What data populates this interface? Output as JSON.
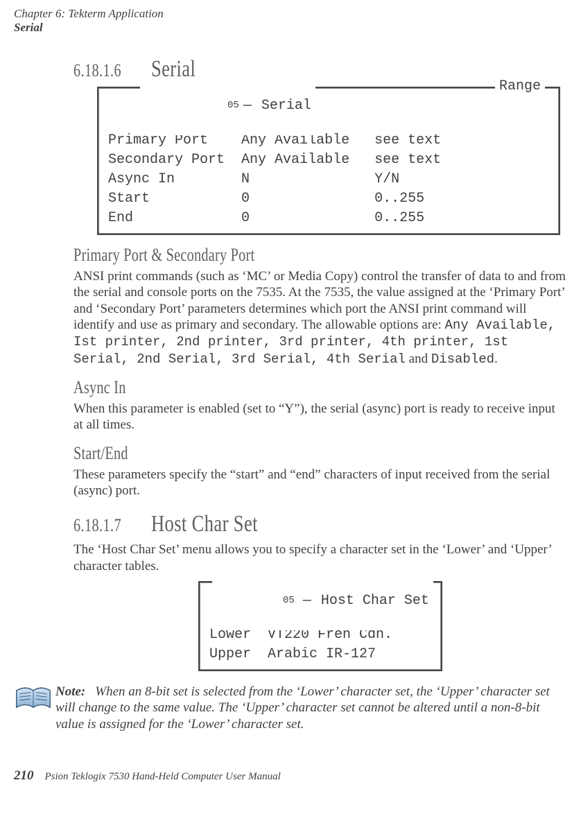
{
  "running_header": {
    "chapter": "Chapter  6:   Tekterm Application",
    "serial": "Serial"
  },
  "section_6_18_1_6": {
    "num": "6.18.1.6",
    "title": "Serial"
  },
  "serial_box": {
    "legend_left_num": "05",
    "legend_left_label": "Serial",
    "legend_right": "Range",
    "rows": [
      {
        "label": "Primary Port",
        "value": "Any Available",
        "range": "see text"
      },
      {
        "label": "Secondary Port",
        "value": "Any Available",
        "range": "see text"
      },
      {
        "label": "Async In",
        "value": "N",
        "range": "Y/N"
      },
      {
        "label": "Start",
        "value": "0",
        "range": "0..255"
      },
      {
        "label": "End",
        "value": "0",
        "range": "0..255"
      }
    ]
  },
  "primary_secondary": {
    "heading": "Primary Port & Secondary Port",
    "para_before_options": "ANSI print commands (such as ‘MC’ or Media Copy) control the transfer of data to and from the serial and console ports on the 7535. At the 7535, the value assigned at the ‘Primary Port’ and ‘Secondary Port’ parameters determines which port the ANSI print command will identify and use as primary and secondary. The allowable options are: ",
    "options_mono": "Any Available, Ist printer, 2nd printer, 3rd printer, 4th printer, 1st Serial, 2nd Serial, 3rd Serial, 4th Serial",
    "and_word": " and ",
    "last_option": "Disabled",
    "period": "."
  },
  "async_in": {
    "heading": "Async In",
    "para": "When this parameter is enabled (set to “Y”), the serial (async) port is ready to receive input at all times."
  },
  "start_end": {
    "heading": "Start/End",
    "para": "These parameters specify the “start” and “end” characters of input received from the serial (async) port."
  },
  "section_6_18_1_7": {
    "num": "6.18.1.7",
    "title": "Host Char Set",
    "para": "The ‘Host Char Set’ menu allows you to specify a character set in the ‘Lower’ and ‘Upper’ character tables."
  },
  "host_char_box": {
    "legend_num": "05",
    "legend_label": "Host Char Set",
    "rows": [
      {
        "label": "Lower",
        "value": "VT220 Fren Cdn."
      },
      {
        "label": "Upper",
        "value": "Arabic IR-127"
      }
    ]
  },
  "note": {
    "label": "Note:",
    "body": "When an 8-bit set is selected from the ‘Lower’ character set, the ‘Upper’ character set will change to the same value. The ‘Upper’ character set cannot be altered until a non-8-bit value is assigned for the ‘Lower’ character set."
  },
  "footer": {
    "page": "210",
    "manual": "Psion Teklogix 7530 Hand-Held Computer User Manual"
  }
}
